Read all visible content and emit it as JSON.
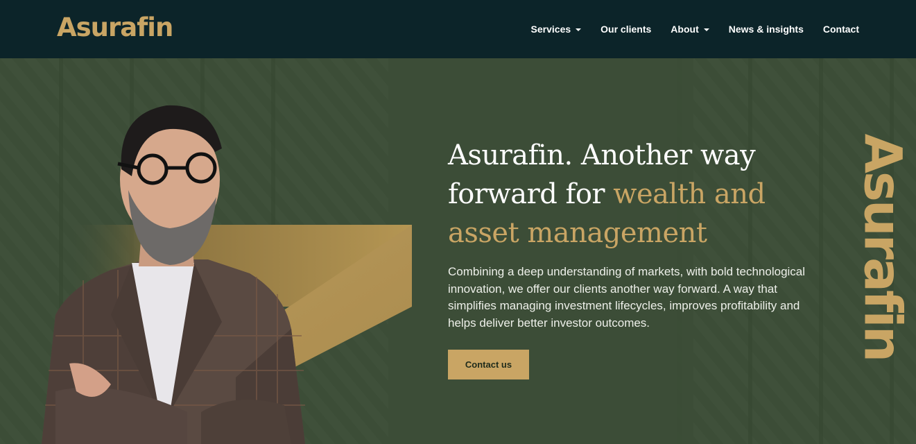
{
  "brand": {
    "logo_text": "Asurafin",
    "accent_color": "#c9a564",
    "header_bg": "#0c2429",
    "hero_bg": "#3c4d37"
  },
  "nav": {
    "items": [
      {
        "label": "Services",
        "has_dropdown": true
      },
      {
        "label": "Our clients",
        "has_dropdown": false
      },
      {
        "label": "About",
        "has_dropdown": true
      },
      {
        "label": "News & insights",
        "has_dropdown": false
      },
      {
        "label": "Contact",
        "has_dropdown": false
      }
    ]
  },
  "hero": {
    "headline_white": "Asurafin. Another way forward for ",
    "headline_gold": "wealth and asset management",
    "description": "Combining a deep understanding of markets, with bold technological innovation, we offer our clients another way forward. A way that simplifies managing investment lifecycles, improves profitability and helps deliver better investor outcomes.",
    "cta_label": "Contact us",
    "vertical_logo_text": "Asurafin"
  }
}
